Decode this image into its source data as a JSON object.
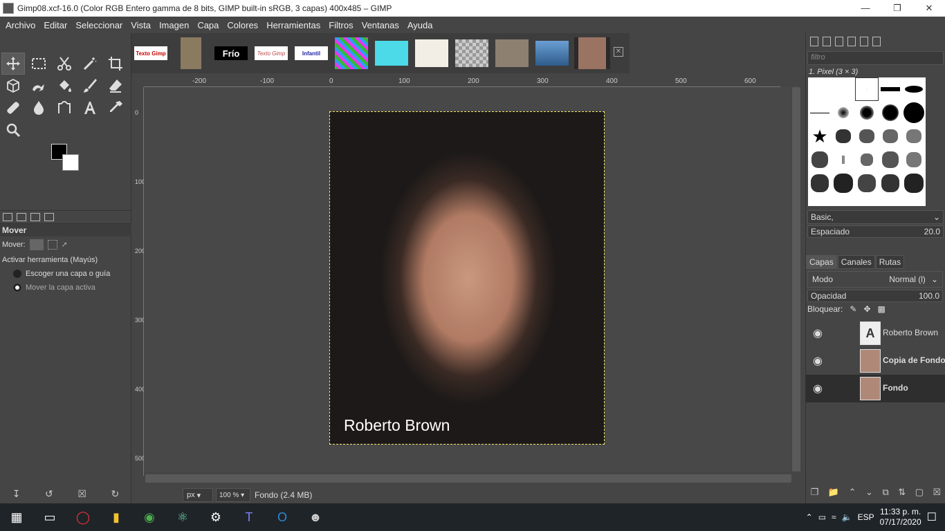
{
  "window": {
    "title": "Gimp08.xcf-16.0 (Color RGB Entero gamma de 8 bits, GIMP built-in sRGB, 3 capas) 400x485 – GIMP"
  },
  "menu": [
    "Archivo",
    "Editar",
    "Seleccionar",
    "Vista",
    "Imagen",
    "Capa",
    "Colores",
    "Herramientas",
    "Filtros",
    "Ventanas",
    "Ayuda"
  ],
  "tools": [
    "move-tool",
    "rect-select-tool",
    "scissors-tool",
    "fuzzy-select-tool",
    "crop-tool",
    "3d-transform-tool",
    "warp-tool",
    "bucket-fill-tool",
    "paintbrush-tool",
    "eraser-tool",
    "heal-tool",
    "smudge-tool",
    "paths-tool",
    "text-tool",
    "color-picker-tool",
    "zoom-tool"
  ],
  "tool_options": {
    "title": "Mover",
    "mover_label": "Mover:",
    "toggle_label": "Activar herramienta  (Mayús)",
    "option1": "Escoger una capa o guía",
    "option2": "Mover la capa activa"
  },
  "thumbnails": [
    "Texto Gimp",
    "Frío",
    "Texto Gimp",
    "Infantil"
  ],
  "ruler": {
    "h": [
      "-200",
      "-100",
      "0",
      "100",
      "200",
      "300",
      "400",
      "500",
      "600"
    ],
    "v": [
      "0",
      "100",
      "200",
      "300",
      "400",
      "500"
    ]
  },
  "image": {
    "caption": "Roberto Brown"
  },
  "status": {
    "unit": "px",
    "zoom": "100 %",
    "layer_info": "Fondo (2.4 MB)"
  },
  "brushes": {
    "filter_placeholder": "filtro",
    "brush_name": "1. Pixel (3 × 3)",
    "preset": "Basic,",
    "spacing_label": "Espaciado",
    "spacing_value": "20.0"
  },
  "layers_panel": {
    "tabs": [
      "Capas",
      "Canales",
      "Rutas"
    ],
    "mode_label": "Modo",
    "mode_value": "Normal (l)",
    "opacity_label": "Opacidad",
    "opacity_value": "100.0",
    "lock_label": "Bloquear:",
    "layers": [
      {
        "name": "Roberto Brown"
      },
      {
        "name": "Copia de Fondo"
      },
      {
        "name": "Fondo"
      }
    ]
  },
  "taskbar": {
    "language": "ESP",
    "time": "11:33 p. m.",
    "date": "07/17/2020"
  }
}
